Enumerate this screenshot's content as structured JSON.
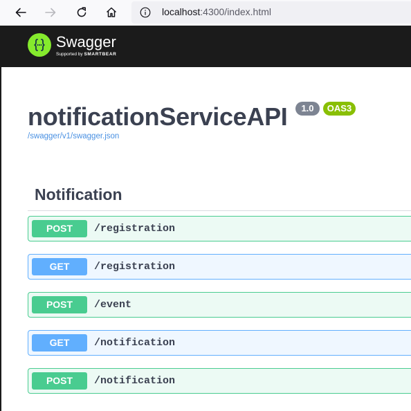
{
  "browser": {
    "url_host": "localhost",
    "url_rest": ":4300/index.html",
    "icons": [
      "back-arrow-icon",
      "forward-arrow-icon",
      "reload-icon",
      "home-icon",
      "info-icon"
    ]
  },
  "topbar": {
    "title": "Swagger",
    "supported_by": "Supported by",
    "brand": "SMARTBEAR",
    "logo_icon": "swagger-braces-icon"
  },
  "info": {
    "title": "notificationServiceAPI",
    "version": "1.0",
    "oas": "OAS3",
    "spec_link": "/swagger/v1/swagger.json"
  },
  "tag": {
    "name": "Notification"
  },
  "operations": [
    {
      "method": "POST",
      "path": "/registration"
    },
    {
      "method": "GET",
      "path": "/registration"
    },
    {
      "method": "POST",
      "path": "/event"
    },
    {
      "method": "GET",
      "path": "/notification"
    },
    {
      "method": "POST",
      "path": "/notification"
    }
  ],
  "colors": {
    "post": "#49cc90",
    "get": "#61affe",
    "topbar_bg": "#1b1b1b",
    "logo_green": "#85ea2d",
    "title_text": "#3b4151",
    "link": "#4990e2"
  }
}
